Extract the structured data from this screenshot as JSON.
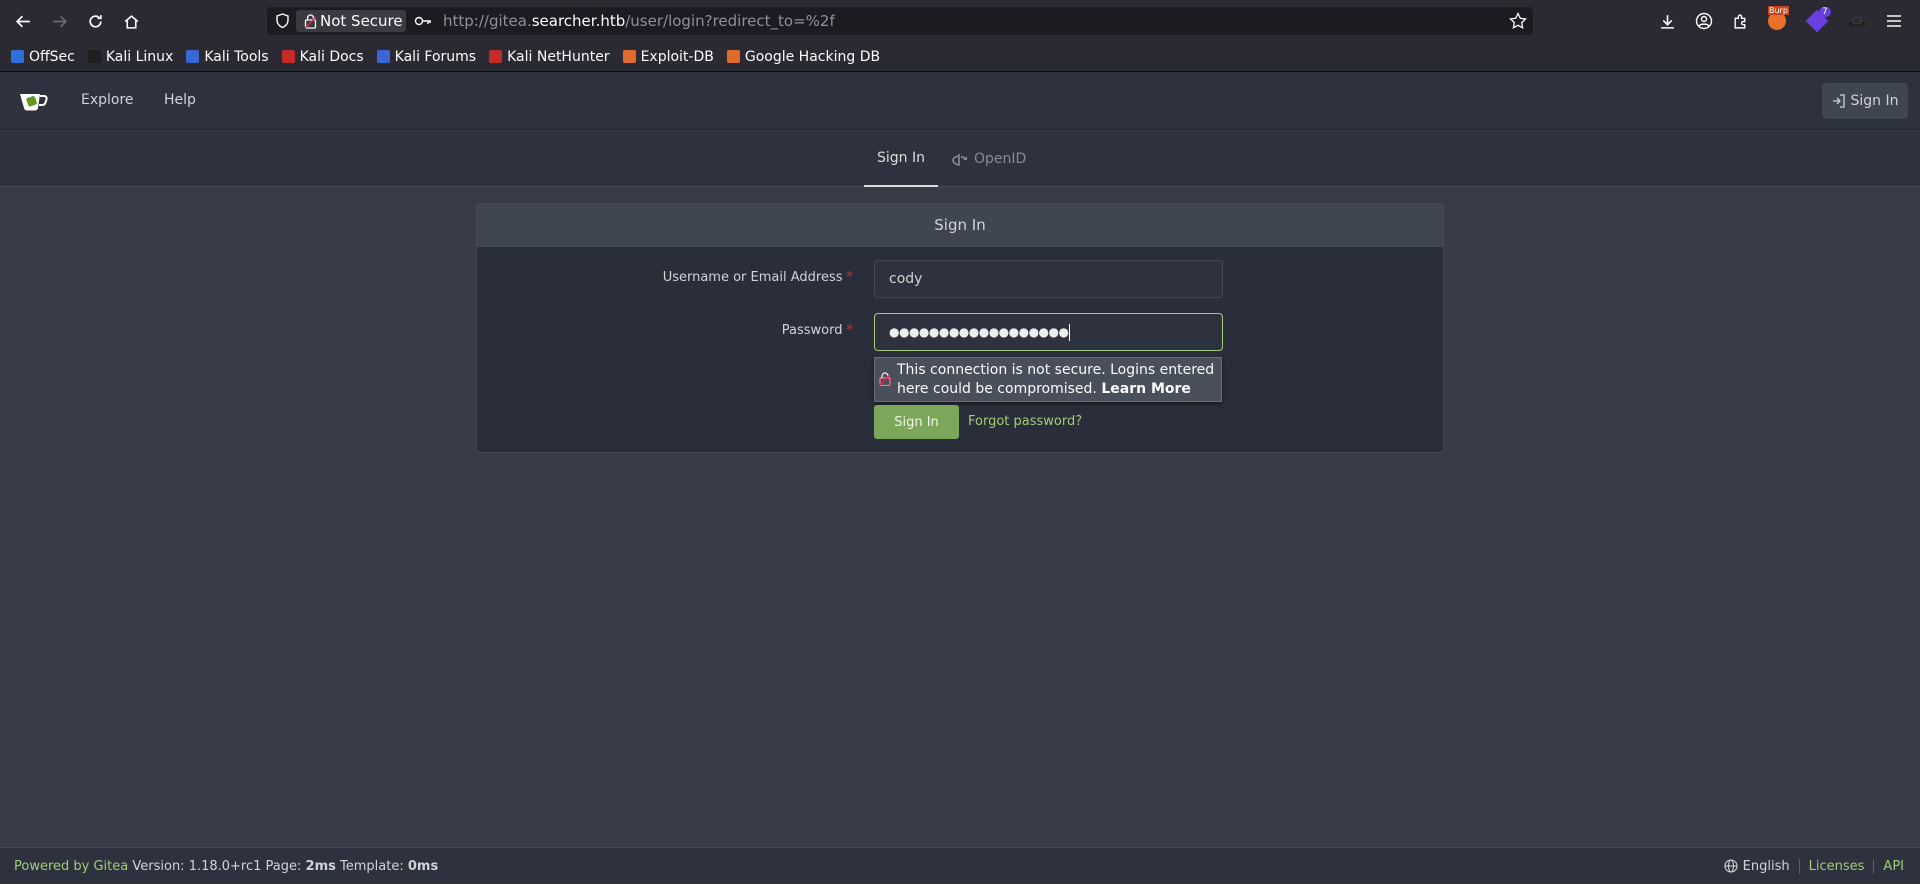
{
  "browser": {
    "security_label": "Not Secure",
    "url_prefix": "http://gitea.",
    "url_domain": "searcher.htb",
    "url_path": "/user/login?redirect_to=%2f",
    "extension_badge_burp": "Burp",
    "extension_badge_count": "7",
    "bookmarks": [
      {
        "label": "OffSec",
        "color": "#2f6fdb"
      },
      {
        "label": "Kali Linux",
        "color": "#1f1f1f"
      },
      {
        "label": "Kali Tools",
        "color": "#3a66d6"
      },
      {
        "label": "Kali Docs",
        "color": "#c42a2a"
      },
      {
        "label": "Kali Forums",
        "color": "#3a66d6"
      },
      {
        "label": "Kali NetHunter",
        "color": "#c42a2a"
      },
      {
        "label": "Exploit-DB",
        "color": "#e0692c"
      },
      {
        "label": "Google Hacking DB",
        "color": "#e0692c"
      }
    ]
  },
  "header": {
    "nav": [
      {
        "label": "Explore"
      },
      {
        "label": "Help"
      }
    ],
    "signin_label": "Sign In"
  },
  "tabs": {
    "signin": "Sign In",
    "openid": "OpenID"
  },
  "form": {
    "title": "Sign In",
    "username_label": "Username or Email Address",
    "username_value": "cody",
    "password_label": "Password",
    "password_mask": "●●●●●●●●●●●●●●●●●●",
    "required_mark": "*",
    "tooltip_text": "This connection is not secure. Logins entered here could be compromised.",
    "tooltip_link": "Learn More",
    "submit_label": "Sign In",
    "forgot_label": "Forgot password?"
  },
  "footer": {
    "powered_by": "Powered by Gitea",
    "version_text": "Version: 1.18.0+rc1 Page:",
    "page_time": "2ms",
    "template_label": "Template:",
    "template_time": "0ms",
    "language": "English",
    "licenses": "Licenses",
    "api": "API"
  },
  "colors": {
    "accent_green": "#a0cc75",
    "button_green": "#7ca659",
    "background": "#383c47"
  }
}
